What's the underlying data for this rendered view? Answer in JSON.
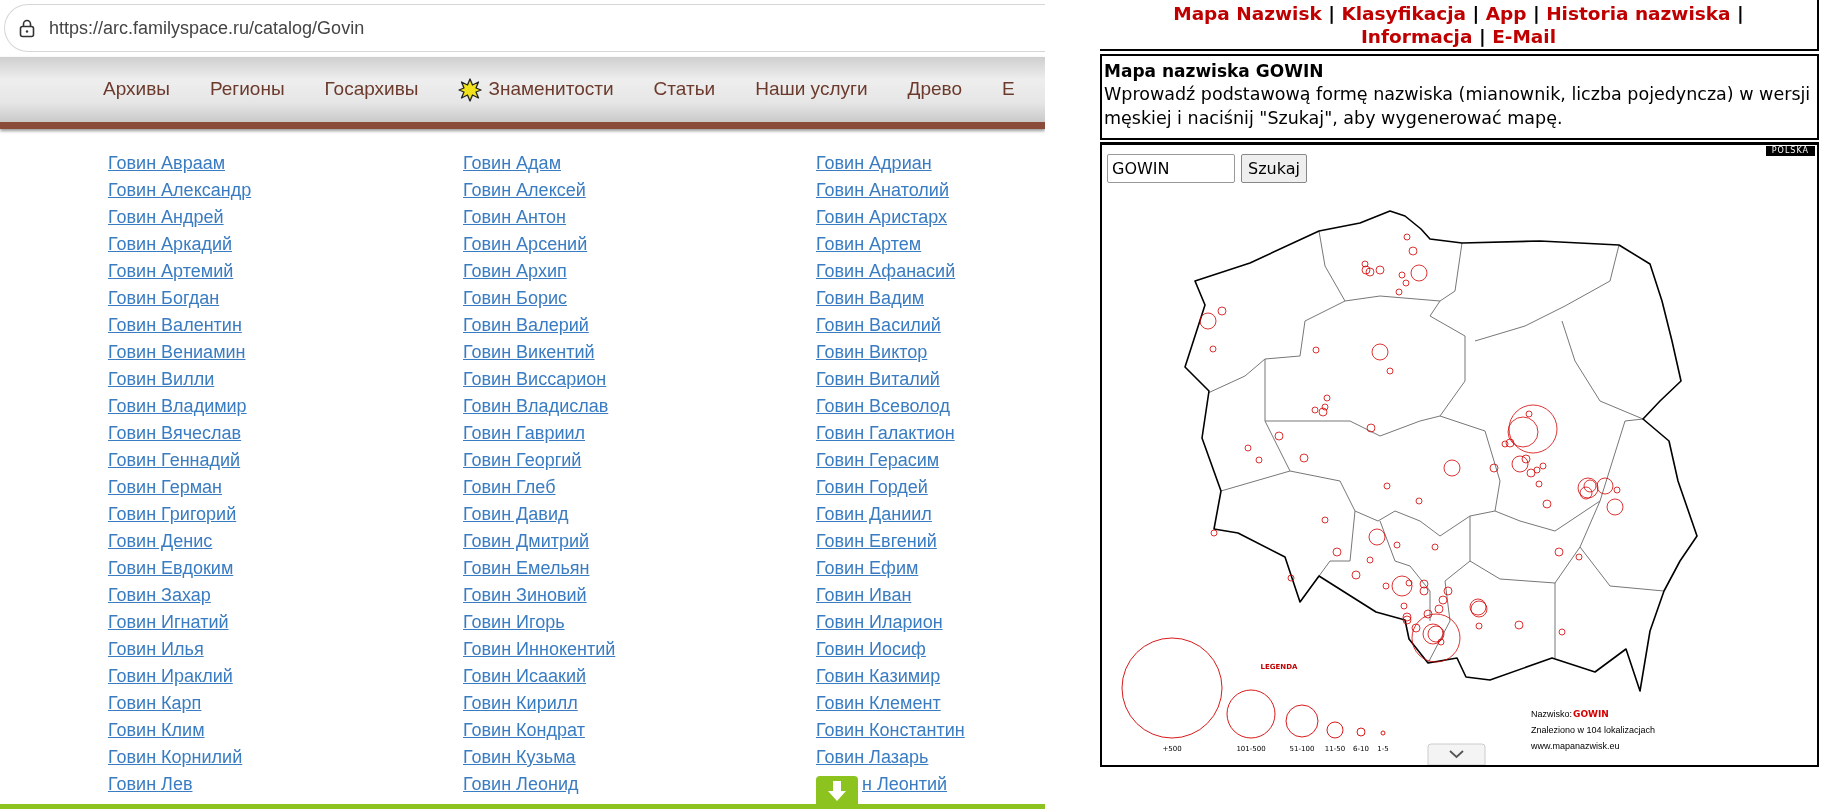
{
  "browser": {
    "url": "https://arc.familyspace.ru/catalog/Govin"
  },
  "site_nav": {
    "items": [
      {
        "label": "Архивы",
        "kind": "plain"
      },
      {
        "label": "Регионы",
        "kind": "plain"
      },
      {
        "label": "Госархивы",
        "kind": "plain"
      },
      {
        "label": "Знаменитости",
        "kind": "featured"
      },
      {
        "label": "Статьи",
        "kind": "plain"
      },
      {
        "label": "Наши услуги",
        "kind": "plain"
      },
      {
        "label": "Древо",
        "kind": "plain"
      },
      {
        "label": "Е",
        "kind": "plain"
      }
    ]
  },
  "names": {
    "columns": [
      [
        "Говин Авраам",
        "Говин Александр",
        "Говин Андрей",
        "Говин Аркадий",
        "Говин Артемий",
        "Говин Богдан",
        "Говин Валентин",
        "Говин Вениамин",
        "Говин Вилли",
        "Говин Владимир",
        "Говин Вячеслав",
        "Говин Геннадий",
        "Говин Герман",
        "Говин Григорий",
        "Говин Денис",
        "Говин Евдоким",
        "Говин Захар",
        "Говин Игнатий",
        "Говин Илья",
        "Говин Ираклий",
        "Говин Карп",
        "Говин Клим",
        "Говин Корнилий",
        "Говин Лев"
      ],
      [
        "Говин Адам",
        "Говин Алексей",
        "Говин Антон",
        "Говин Арсений",
        "Говин Архип",
        "Говин Борис",
        "Говин Валерий",
        "Говин Викентий",
        "Говин Виссарион",
        "Говин Владислав",
        "Говин Гавриил",
        "Говин Георгий",
        "Говин Глеб",
        "Говин Давид",
        "Говин Дмитрий",
        "Говин Емельян",
        "Говин Зиновий",
        "Говин Игорь",
        "Говин Иннокентий",
        "Говин Исаакий",
        "Говин Кирилл",
        "Говин Кондрат",
        "Говин Кузьма",
        "Говин Леонид"
      ],
      [
        "Говин Адриан",
        "Говин Анатолий",
        "Говин Аристарх",
        "Говин Артем",
        "Говин Афанасий",
        "Говин Вадим",
        "Говин Василий",
        "Говин Виктор",
        "Говин Виталий",
        "Говин Всеволод",
        "Говин Галактион",
        "Говин Герасим",
        "Говин Гордей",
        "Говин Даниил",
        "Говин Евгений",
        "Говин Ефим",
        "Говин Иван",
        "Говин Иларион",
        "Говин Иосиф",
        "Говин Казимир",
        "Говин Клемент",
        "Говин Константин",
        "Говин Лазарь",
        "н Леонтий"
      ]
    ]
  },
  "surname_map": {
    "menu": [
      {
        "kind": "link",
        "text": "Mapa Nazwisk"
      },
      {
        "kind": "separator",
        "text": "|"
      },
      {
        "kind": "link",
        "text": "Klasyfikacja"
      },
      {
        "kind": "separator",
        "text": "|"
      },
      {
        "kind": "link",
        "text": "App"
      },
      {
        "kind": "separator",
        "text": "|"
      },
      {
        "kind": "link",
        "text": "Historia nazwiska"
      },
      {
        "kind": "separator",
        "text": "|"
      },
      {
        "kind": "link",
        "text": "Informacja"
      },
      {
        "kind": "separator",
        "text": "|"
      },
      {
        "kind": "link",
        "text": "E-Mail"
      }
    ],
    "title": "Mapa nazwiska GOWIN",
    "instructions": "Wprowadź podstawową formę nazwiska (mianownik, liczba pojedyncza) w wersji męskiej i naciśnij \"Szukaj\", aby wygenerować mapę.",
    "search": {
      "value": "GOWIN",
      "button": "Szukaj"
    },
    "country_badge": "POLSKA",
    "legend": {
      "title": "LEGENDA",
      "sizes": [
        "+500",
        "101-500",
        "51-100",
        "11-50",
        "6-10",
        "1-5"
      ]
    },
    "result": {
      "label": "Nazwisko:",
      "surname": "GOWIN",
      "found": "Znaleziono w 104 lokalizacjach",
      "website": "www.mapanazwisk.eu"
    }
  }
}
